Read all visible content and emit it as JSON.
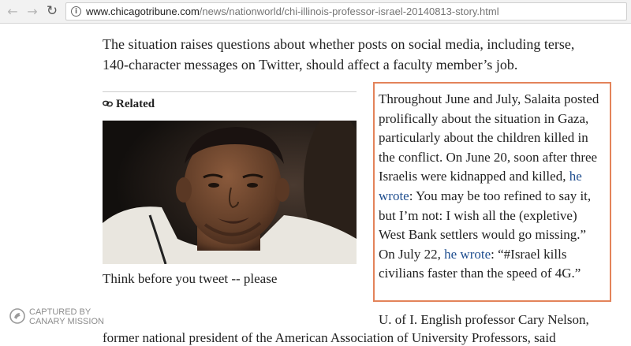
{
  "browser": {
    "url_domain": "www.chicagotribune.com",
    "url_path": "/news/nationworld/chi-illinois-professor-israel-20140813-story.html"
  },
  "article": {
    "intro": "The situation raises questions about whether posts on social media, including terse, 140-character messages on Twitter, should affect a faculty member’s job.",
    "related": {
      "heading": "Related",
      "caption": "Think before you tweet -- please"
    },
    "quote": {
      "p1": "Throughout June and July, Salaita posted prolifically about the situation in Gaza, particularly about the children killed in the conflict. On June 20, soon after three Israelis were kidnapped and killed, ",
      "link1": "he wrote",
      "p2": ": You may be too refined to say it, but I’m not: I wish all the (expletive) West Bank settlers would go missing.” On July 22, ",
      "link2": "he wrote",
      "p3": ": “#Israel kills civilians faster than the speed of 4G.”"
    },
    "after_box": "U. of I. English professor Cary Nelson,",
    "cut_line": "former national president of the American Association of University Professors, said"
  },
  "watermark": {
    "line1": "CAPTURED BY",
    "line2": "CANARY MISSION"
  },
  "colors": {
    "quote_border": "#e3835a",
    "link": "#1f4e8f"
  }
}
